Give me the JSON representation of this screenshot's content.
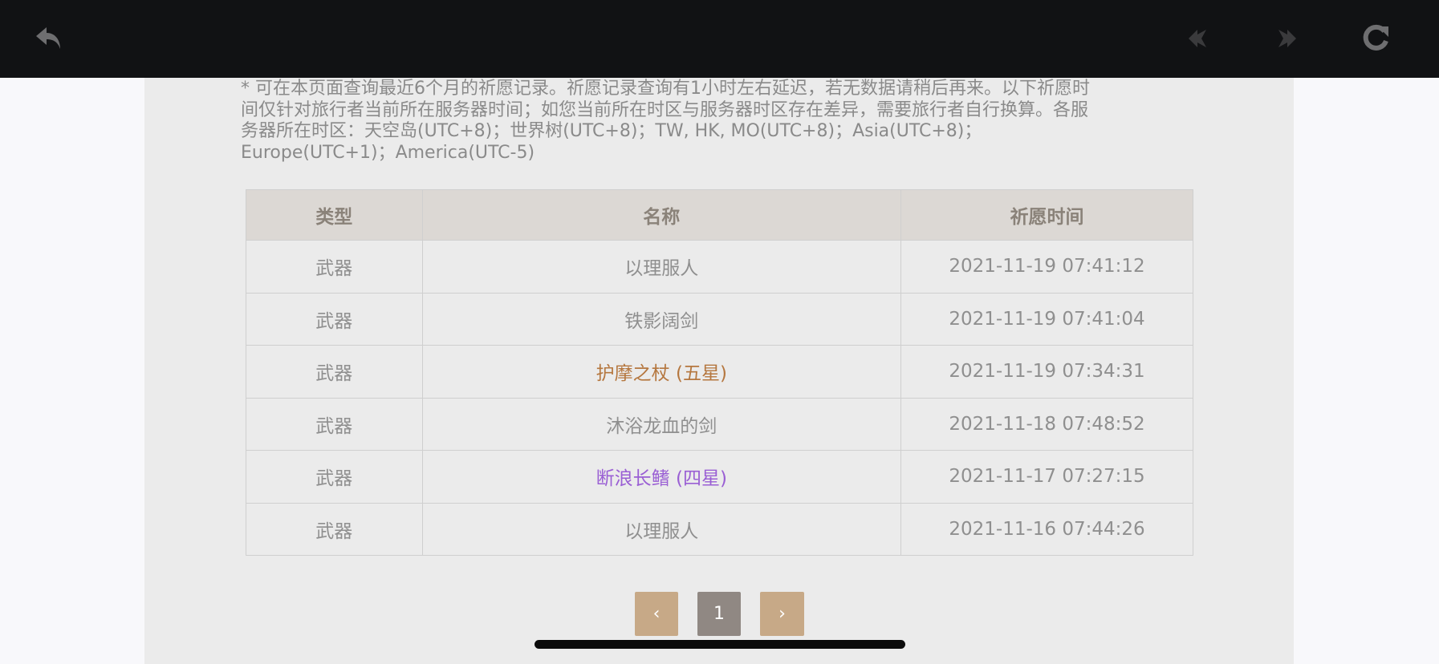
{
  "toolbar": {
    "back_icon": "undo-arrow-icon",
    "prev_icon": "diamond-left-icon",
    "next_icon": "diamond-right-icon",
    "refresh_icon": "refresh-icon"
  },
  "notice": "* 可在本页面查询最近6个月的祈愿记录。祈愿记录查询有1小时左右延迟，若无数据请稍后再来。以下祈愿时间仅针对旅行者当前所在服务器时间；如您当前所在时区与服务器时区存在差异，需要旅行者自行换算。各服务器所在时区：天空岛(UTC+8)；世界树(UTC+8)；TW, HK, MO(UTC+8)；Asia(UTC+8)；Europe(UTC+1)；America(UTC-5)",
  "table": {
    "headers": [
      "类型",
      "名称",
      "祈愿时间"
    ],
    "rows": [
      {
        "type": "武器",
        "name": "以理服人",
        "time": "2021-11-19 07:41:12",
        "color": "#8f8f8f"
      },
      {
        "type": "武器",
        "name": "铁影阔剑",
        "time": "2021-11-19 07:41:04",
        "color": "#8f8f8f"
      },
      {
        "type": "武器",
        "name": "护摩之杖 (五星)",
        "time": "2021-11-19 07:34:31",
        "color": "#b5773f"
      },
      {
        "type": "武器",
        "name": "沐浴龙血的剑",
        "time": "2021-11-18 07:48:52",
        "color": "#8f8f8f"
      },
      {
        "type": "武器",
        "name": "断浪长鳍 (四星)",
        "time": "2021-11-17 07:27:15",
        "color": "#9a5fd4"
      },
      {
        "type": "武器",
        "name": "以理服人",
        "time": "2021-11-16 07:44:26",
        "color": "#8f8f8f"
      }
    ]
  },
  "pagination": {
    "prev_label": "‹",
    "current_page": "1",
    "next_label": "›"
  },
  "colors": {
    "five_star": "#b5773f",
    "four_star": "#9a5fd4",
    "pager_arrow": "#c7a987",
    "pager_current": "#908883"
  }
}
